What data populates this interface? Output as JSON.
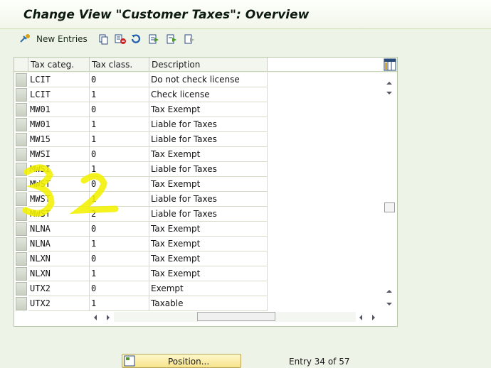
{
  "title": "Change View \"Customer Taxes\": Overview",
  "toolbar": {
    "new_entries": "New Entries",
    "icons": [
      "choose-icon",
      "copy-icon",
      "delete-icon",
      "undo-icon",
      "select-all-icon",
      "select-block-icon",
      "deselect-all-icon"
    ]
  },
  "table": {
    "headers": [
      "Tax categ.",
      "Tax class.",
      "Description"
    ],
    "rows": [
      {
        "categ": "LCIT",
        "class": "0",
        "desc": "Do not check license"
      },
      {
        "categ": "LCIT",
        "class": "1",
        "desc": "Check license"
      },
      {
        "categ": "MW01",
        "class": "0",
        "desc": "Tax Exempt"
      },
      {
        "categ": "MW01",
        "class": "1",
        "desc": "Liable for Taxes"
      },
      {
        "categ": "MW15",
        "class": "1",
        "desc": "Liable for Taxes"
      },
      {
        "categ": "MWSI",
        "class": "0",
        "desc": "Tax Exempt"
      },
      {
        "categ": "MWSI",
        "class": "1",
        "desc": "Liable for Taxes"
      },
      {
        "categ": "MWST",
        "class": "0",
        "desc": "Tax Exempt"
      },
      {
        "categ": "MWST",
        "class": "1",
        "desc": "Liable for Taxes"
      },
      {
        "categ": "MWST",
        "class": "2",
        "desc": "Liable for Taxes"
      },
      {
        "categ": "NLNA",
        "class": "0",
        "desc": "Tax Exempt"
      },
      {
        "categ": "NLNA",
        "class": "1",
        "desc": "Tax Exempt"
      },
      {
        "categ": "NLXN",
        "class": "0",
        "desc": "Tax Exempt"
      },
      {
        "categ": "NLXN",
        "class": "1",
        "desc": "Tax Exempt"
      },
      {
        "categ": "UTX2",
        "class": "0",
        "desc": "Exempt"
      },
      {
        "categ": "UTX2",
        "class": "1",
        "desc": "Taxable"
      }
    ]
  },
  "annotation": {
    "text": "3 2",
    "color": "#f2f000"
  },
  "position_button": "Position...",
  "entry_status": "Entry 34 of 57",
  "colors": {
    "accent": "#f6e38b",
    "background": "#eef3e8"
  }
}
